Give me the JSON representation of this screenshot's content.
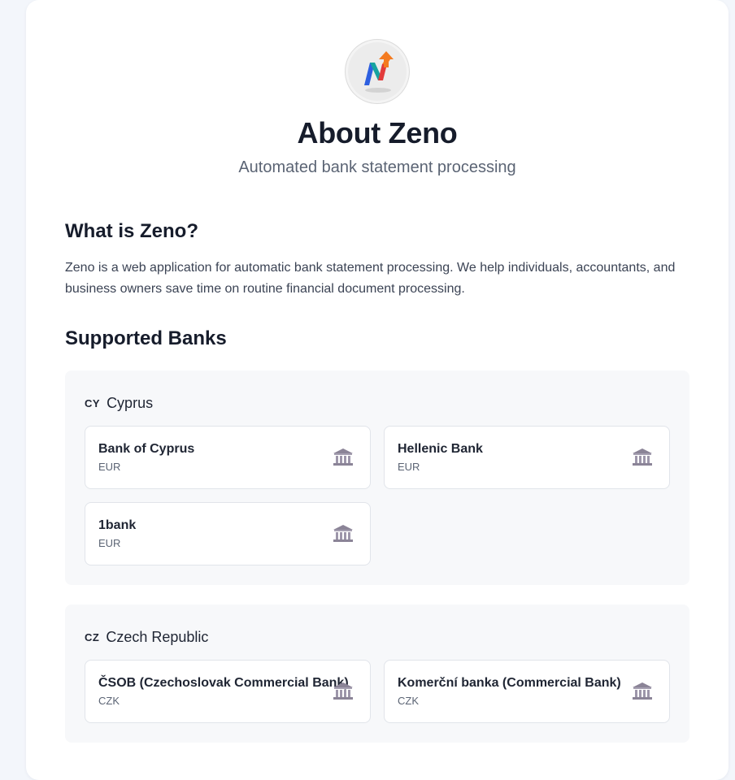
{
  "header": {
    "title": "About Zeno",
    "subtitle": "Automated bank statement processing"
  },
  "about": {
    "heading": "What is Zeno?",
    "description": "Zeno is a web application for automatic bank statement processing. We help individuals, accountants, and business owners save time on routine financial document processing."
  },
  "banks": {
    "heading": "Supported Banks",
    "countries": [
      {
        "code": "CY",
        "name": "Cyprus",
        "banks": [
          {
            "name": "Bank of Cyprus",
            "currency": "EUR",
            "icon": "bank-icon"
          },
          {
            "name": "Hellenic Bank",
            "currency": "EUR",
            "icon": "bank-icon"
          },
          {
            "name": "1bank",
            "currency": "EUR",
            "icon": "bank-icon"
          }
        ]
      },
      {
        "code": "CZ",
        "name": "Czech Republic",
        "banks": [
          {
            "name": "ČSOB (Czechoslovak Commercial Bank)",
            "currency": "CZK",
            "icon": "bank-icon"
          },
          {
            "name": "Komerční banka (Commercial Bank)",
            "currency": "CZK",
            "icon": "bank-icon"
          }
        ]
      }
    ]
  },
  "colors": {
    "background": "#f3f6fb",
    "card": "#ffffff",
    "heading": "#161c2b",
    "muted": "#5b6474",
    "country_panel": "#f7f8fa",
    "logo_blue": "#2d5fe0",
    "logo_orange": "#f47b20",
    "logo_red": "#e23b3b"
  }
}
